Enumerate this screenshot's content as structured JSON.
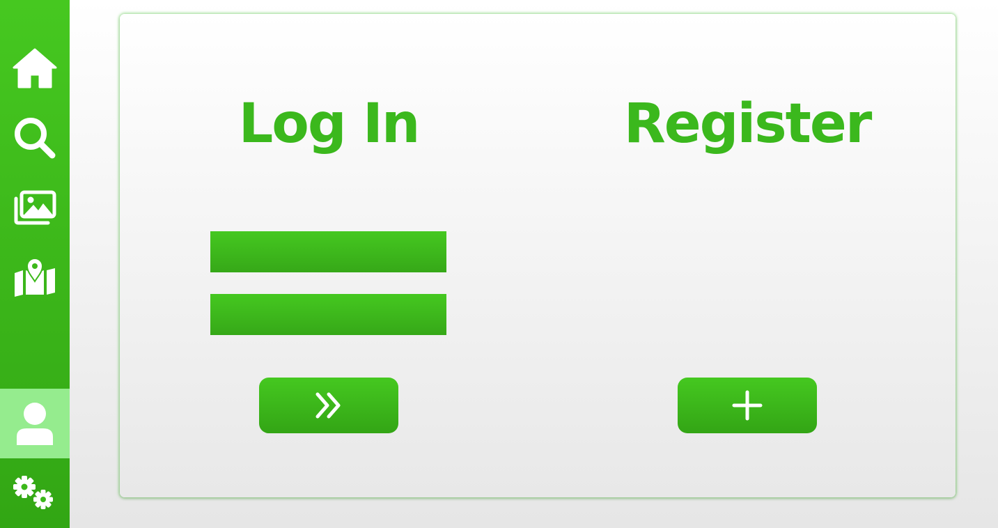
{
  "theme": {
    "accent": "#3bb81d",
    "sidebar_top": "#46c820",
    "sidebar_bottom": "#32a614",
    "active_item": "#95ec8e"
  },
  "sidebar": {
    "items": [
      {
        "icon": "home-icon"
      },
      {
        "icon": "search-icon"
      },
      {
        "icon": "photo-gallery-icon"
      },
      {
        "icon": "map-pin-icon"
      },
      {
        "icon": "user-icon",
        "active": true
      },
      {
        "icon": "gears-icon"
      }
    ]
  },
  "login": {
    "title": "Log In",
    "username": {
      "value": "",
      "placeholder": ""
    },
    "password": {
      "value": "",
      "placeholder": ""
    },
    "submit_icon": "double-chevron-right-icon"
  },
  "register": {
    "title": "Register",
    "add_icon": "plus-icon"
  }
}
